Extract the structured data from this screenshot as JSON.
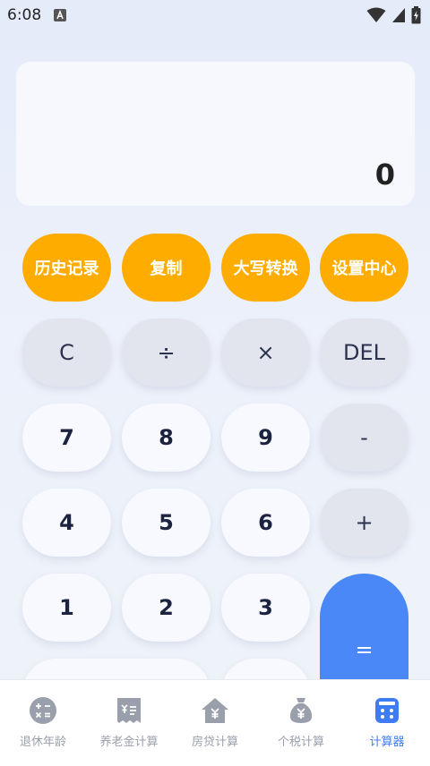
{
  "status": {
    "time": "6:08"
  },
  "display": {
    "value": "0"
  },
  "function_buttons": {
    "history": "历史记录",
    "copy": "复制",
    "uppercase": "大写转换",
    "settings": "设置中心"
  },
  "keys": {
    "clear": "C",
    "divide": "÷",
    "multiply": "×",
    "delete": "DEL",
    "seven": "7",
    "eight": "8",
    "nine": "9",
    "minus": "-",
    "four": "4",
    "five": "5",
    "six": "6",
    "plus": "+",
    "one": "1",
    "two": "2",
    "three": "3",
    "equals": "="
  },
  "tabs": [
    {
      "label": "退休年龄",
      "icon": "calculator-round-icon"
    },
    {
      "label": "养老金计算",
      "icon": "receipt-icon"
    },
    {
      "label": "房贷计算",
      "icon": "house-yuan-icon"
    },
    {
      "label": "个税计算",
      "icon": "money-bag-icon"
    },
    {
      "label": "计算器",
      "icon": "calculator-icon"
    }
  ],
  "colors": {
    "accent": "#ffac00",
    "primary": "#4a88f7",
    "tab_active": "#3f7cf4",
    "tab_inactive": "#9aa0ab"
  }
}
